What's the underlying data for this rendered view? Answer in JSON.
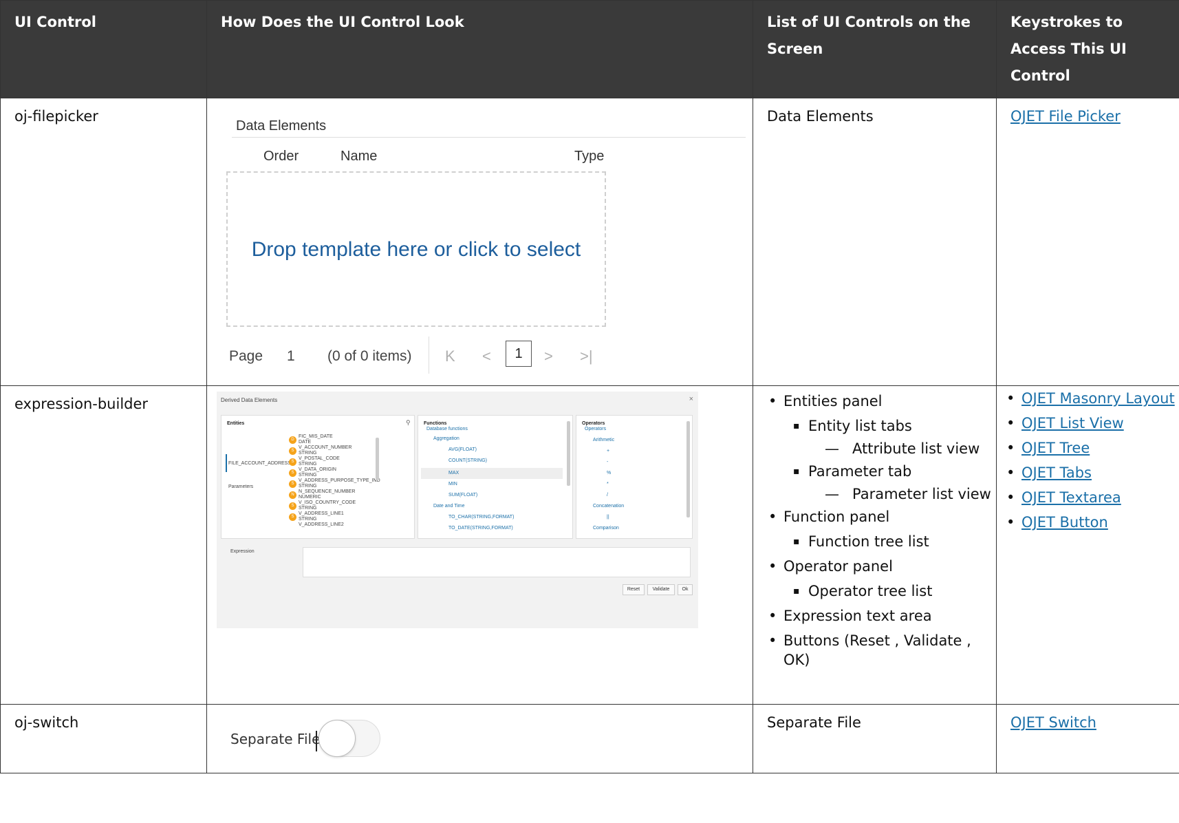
{
  "headers": [
    "UI Control",
    "How Does the UI Control Look",
    "List of UI Controls on the Screen",
    "Keystrokes to Access This UI Control"
  ],
  "rows": [
    {
      "control": "oj-filepicker",
      "controls_list": "Data Elements",
      "link": "OJET File Picker",
      "preview": {
        "title": "Data Elements",
        "columns": [
          "Order",
          "Name",
          "Type"
        ],
        "drop_text": "Drop template here or click to select",
        "page_label": "Page",
        "page_number": "1",
        "items": "(0 of 0 items)",
        "current_page": "1"
      }
    },
    {
      "control": "expression-builder",
      "links": [
        "OJET Masonry Layout",
        "OJET List View",
        "OJET Tree",
        "OJET Tabs",
        "OJET Textarea",
        "OJET Button"
      ],
      "list": {
        "entities_panel": "Entities panel",
        "entity_list_tabs": "Entity list tabs",
        "attribute_list_view": "Attribute list view",
        "parameter_tab": "Parameter tab",
        "parameter_list_view": "Parameter list view",
        "function_panel": "Function panel",
        "function_tree_list": "Function tree list",
        "operator_panel": "Operator panel",
        "operator_tree_list": "Operator tree list",
        "expression_text_area": "Expression text area",
        "buttons": "Buttons (Reset , Validate , OK)"
      },
      "preview": {
        "title": "Derived Data Elements",
        "close": "×",
        "entities_header": "Entities",
        "entity_tabs": [
          "FILE_ACCOUNT_ADDRESS",
          "Parameters"
        ],
        "attributes": [
          {
            "name": "FIC_MIS_DATE",
            "type": "DATE",
            "badge": "D"
          },
          {
            "name": "V_ACCOUNT_NUMBER",
            "type": "STRING",
            "badge": "S"
          },
          {
            "name": "V_POSTAL_CODE",
            "type": "STRING",
            "badge": "S"
          },
          {
            "name": "V_DATA_ORIGIN",
            "type": "STRING",
            "badge": "S"
          },
          {
            "name": "V_ADDRESS_PURPOSE_TYPE_IND",
            "type": "STRING",
            "badge": "S"
          },
          {
            "name": "N_SEQUENCE_NUMBER",
            "type": "NUMERIC",
            "badge": "N"
          },
          {
            "name": "V_ISO_COUNTRY_CODE",
            "type": "STRING",
            "badge": "S"
          },
          {
            "name": "V_ADDRESS_LINE1",
            "type": "STRING",
            "badge": "S"
          },
          {
            "name": "V_ADDRESS_LINE2",
            "type": "",
            "badge": ""
          }
        ],
        "functions_header": "Functions",
        "functions": [
          "Database functions",
          "Aggregation",
          "AVG(FLOAT)",
          "COUNT(STRING)",
          "MAX",
          "MIN",
          "SUM(FLOAT)",
          "Date and Time",
          "TO_CHAR(STRING,FORMAT)",
          "TO_DATE(STRING,FORMAT)"
        ],
        "operators_header": "Operators",
        "operators": [
          "Operators",
          "Arithmetic",
          "+",
          "-",
          "%",
          "*",
          "/",
          "Concatenation",
          "||",
          "Comparison"
        ],
        "expression_label": "Expression",
        "buttons": [
          "Reset",
          "Validate",
          "Ok"
        ]
      }
    },
    {
      "control": "oj-switch",
      "controls_list": "Separate File",
      "link": "OJET Switch",
      "preview": {
        "label": "Separate File",
        "checked": false
      }
    }
  ]
}
